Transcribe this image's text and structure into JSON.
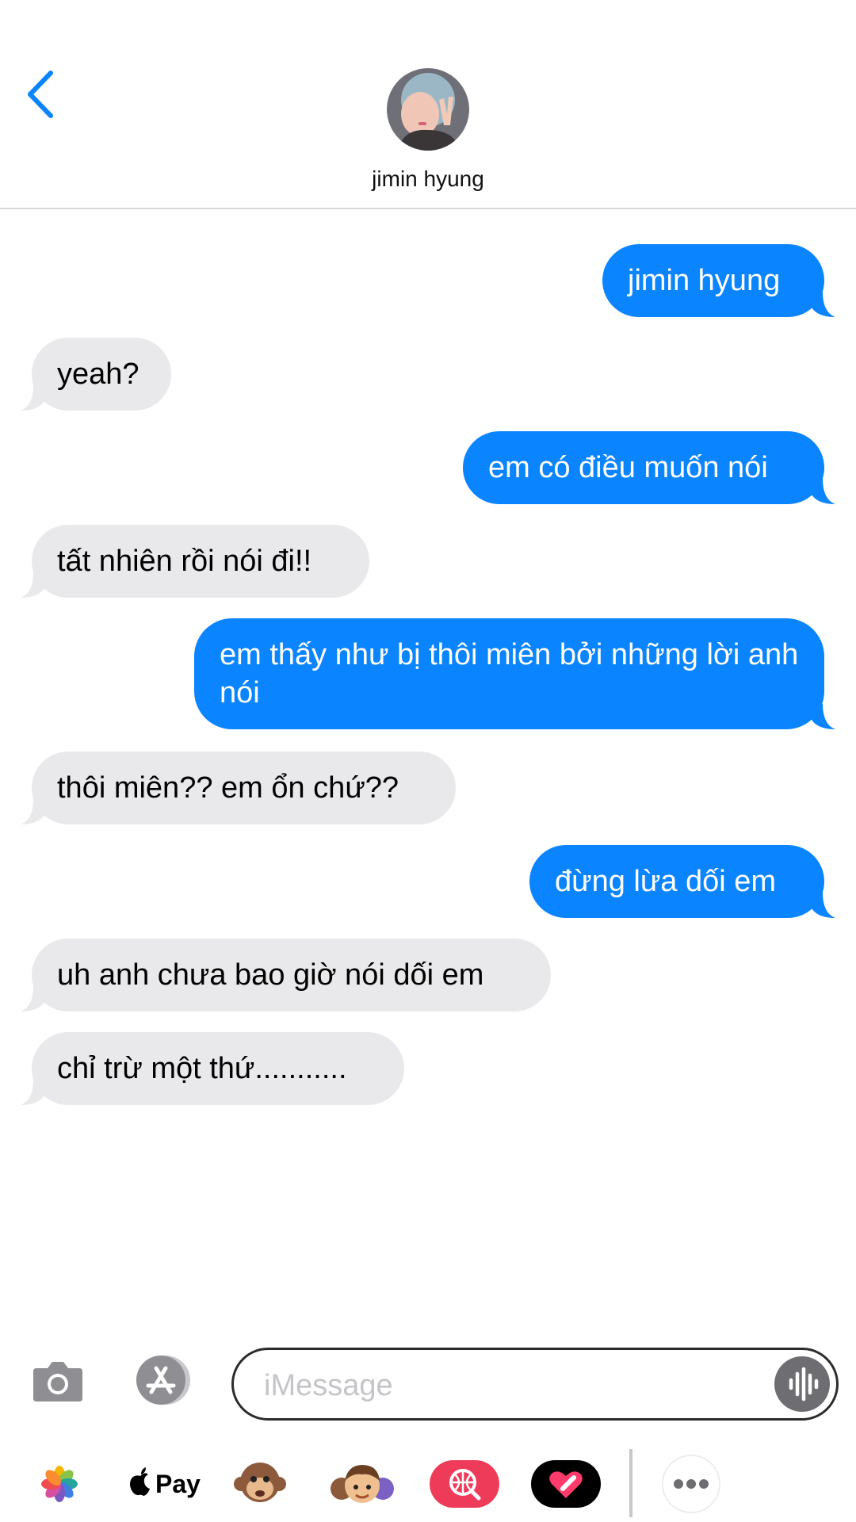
{
  "contact": {
    "name": "jimin hyung"
  },
  "messages": [
    {
      "dir": "sent",
      "text": "jimin hyung"
    },
    {
      "dir": "recv",
      "text": "yeah?"
    },
    {
      "dir": "sent",
      "text": "em có điều muốn nói"
    },
    {
      "dir": "recv",
      "text": "tất nhiên rồi nói đi!!"
    },
    {
      "dir": "sent",
      "text": "em thấy như bị thôi miên bởi những lời anh nói"
    },
    {
      "dir": "recv",
      "text": "thôi miên?? em ổn chứ??"
    },
    {
      "dir": "sent",
      "text": "đừng lừa dối em"
    },
    {
      "dir": "recv",
      "text": "uh anh chưa bao giờ nói dối em"
    },
    {
      "dir": "recv",
      "text": "chỉ trừ một thứ..........."
    }
  ],
  "composer": {
    "placeholder": "iMessage",
    "value": ""
  },
  "app_drawer": {
    "items": [
      {
        "name": "photos-icon"
      },
      {
        "name": "apple-pay-icon",
        "label": "Pay"
      },
      {
        "name": "animoji-icon"
      },
      {
        "name": "memoji-icon"
      },
      {
        "name": "web-search-icon"
      },
      {
        "name": "digital-touch-icon"
      },
      {
        "name": "more-icon"
      }
    ]
  },
  "colors": {
    "sent_bubble": "#0a84ff",
    "received_bubble": "#e9e9eb",
    "accent": "#0a84ff",
    "battery": "#ffcc00"
  }
}
